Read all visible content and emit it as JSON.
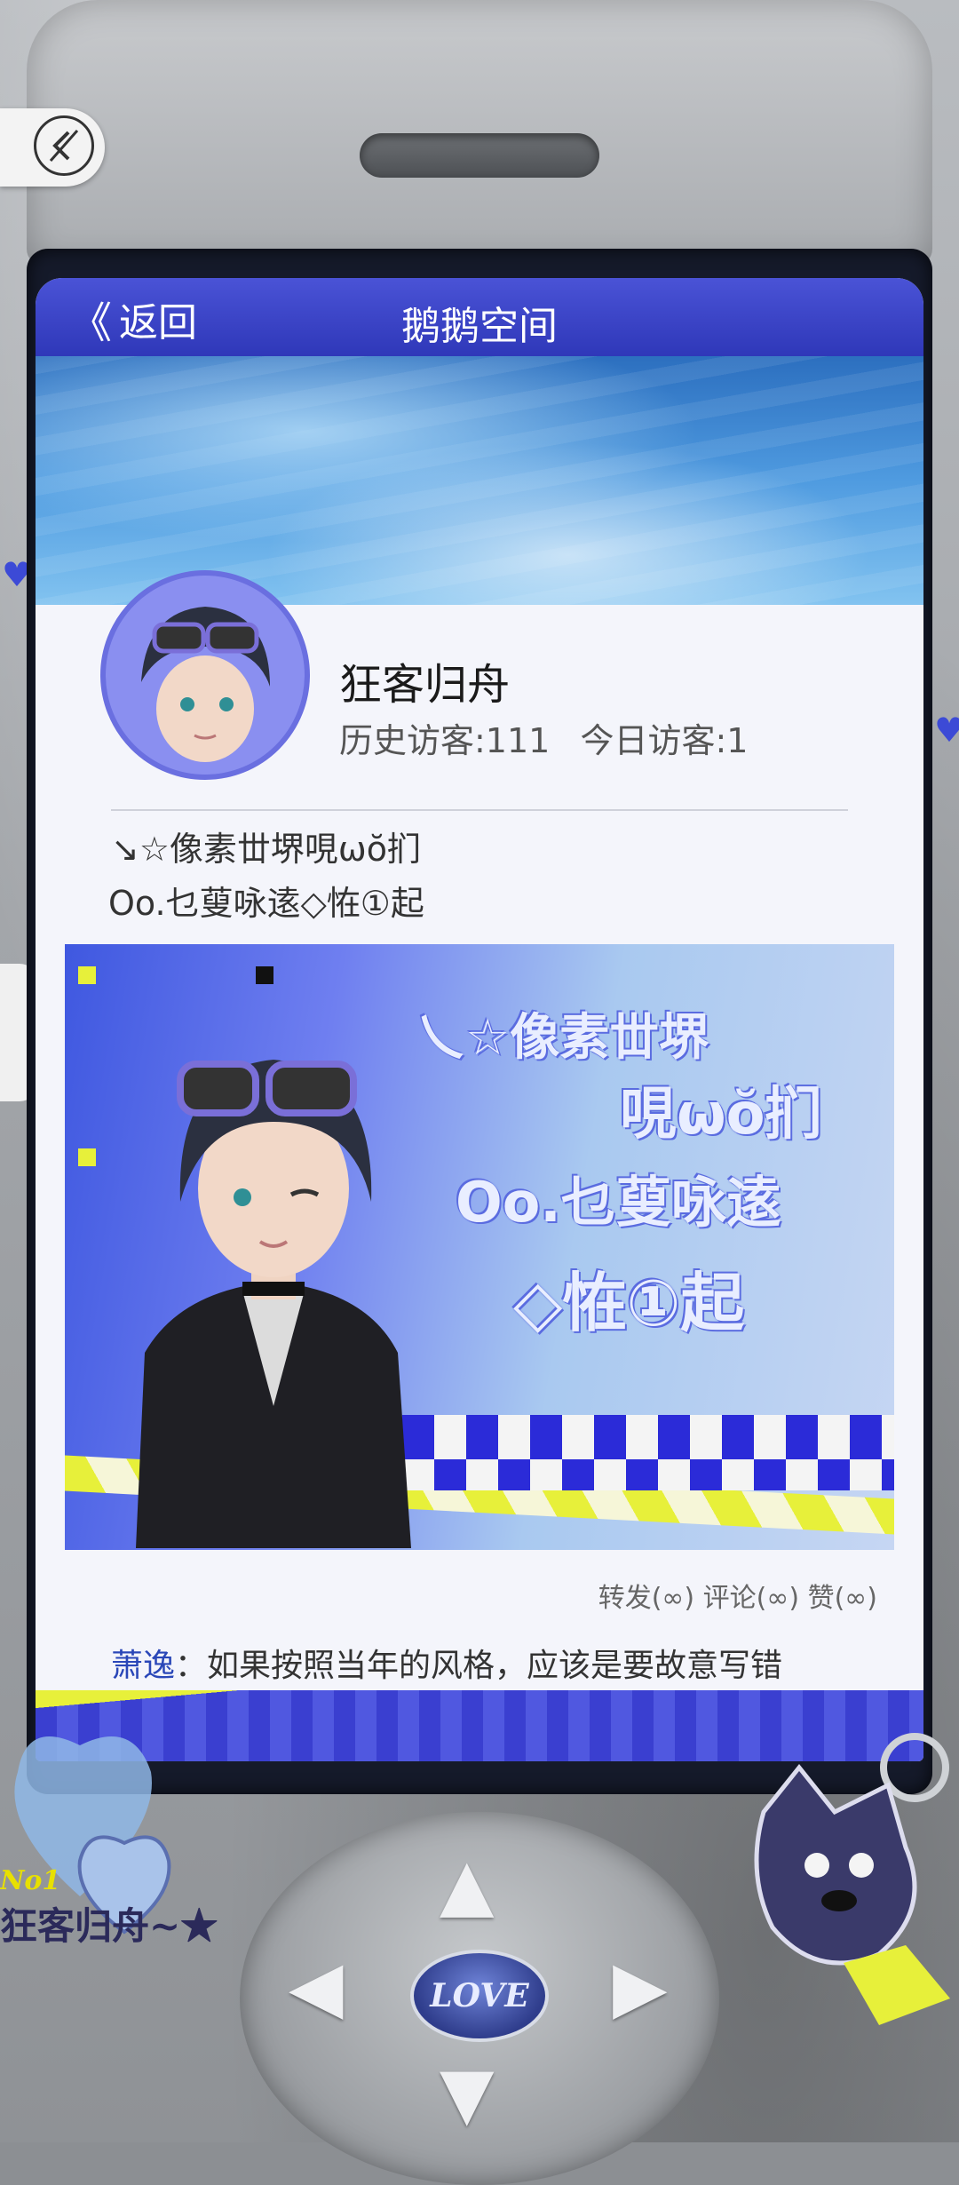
{
  "nav": {
    "back_label": "返回",
    "title": "鹅鹅空间"
  },
  "profile": {
    "name": "狂客归舟",
    "history_visitors": "历史访客:111",
    "today_visitors": "今日访客:1"
  },
  "signature": {
    "line1": "↘☆像素丗堺哯ωŏ扪",
    "line2": "Oo.乜蓃咏逺◇恠①起"
  },
  "post": {
    "image_text": [
      "乀☆像素丗堺",
      "哯ωŏ扪",
      "Oo.乜蓃咏逺",
      "◇恠①起"
    ],
    "stats": "转发(∞) 评论(∞) 赞(∞)",
    "comment_author": "萧逸",
    "comment_text": "：如果按照当年的风格，应该是要故意写错"
  },
  "keypad": {
    "love_label": "LOVE"
  },
  "sticker": {
    "badge": "No1",
    "text": "狂客归舟~★"
  },
  "colors": {
    "nav_blue": "#3a43c8",
    "accent_yellow": "#e7f03a",
    "commenter_name": "#2a47b8"
  },
  "icons": {
    "exit": "exit-icon",
    "back_chevron": "chevron-left-icon",
    "heart": "heart-icon"
  }
}
